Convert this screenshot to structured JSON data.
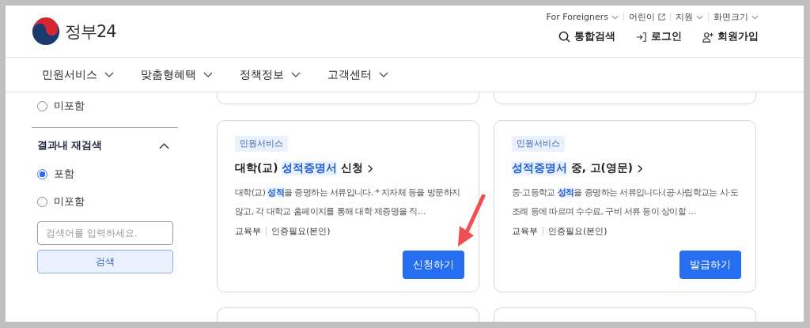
{
  "header": {
    "logo": {
      "text": "정부24"
    },
    "utility_links": [
      {
        "label": "For Foreigners",
        "kind": "dropdown"
      },
      {
        "label": "어린이",
        "kind": "external"
      },
      {
        "label": "지원",
        "kind": "dropdown"
      },
      {
        "label": "화면크기",
        "kind": "dropdown"
      }
    ],
    "actions": [
      {
        "label": "통합검색",
        "kind": "search"
      },
      {
        "label": "로그인",
        "kind": "login"
      },
      {
        "label": "회원가입",
        "kind": "signup"
      }
    ]
  },
  "nav": [
    {
      "label": "민원서비스"
    },
    {
      "label": "맞춤형혜택"
    },
    {
      "label": "정책정보"
    },
    {
      "label": "고객센터"
    }
  ],
  "sidebar": {
    "prev_options": [
      {
        "label": "미포함",
        "selected": false
      }
    ],
    "section": {
      "title": "결과내 재검색",
      "expanded": true,
      "options": [
        {
          "label": "포함",
          "selected": true
        },
        {
          "label": "미포함",
          "selected": false
        }
      ],
      "search": {
        "placeholder": "검색어를 입력하세요.",
        "button": "검색"
      }
    }
  },
  "results": [
    {
      "tag": "민원서비스",
      "title": [
        {
          "text": "대학(교) ",
          "highlight": false
        },
        {
          "text": "성적증명서",
          "highlight": true
        },
        {
          "text": " 신청",
          "highlight": false
        }
      ],
      "description": [
        {
          "text": "대학(교) ",
          "highlight": false
        },
        {
          "text": "성적",
          "highlight": true
        },
        {
          "text": "을 증명하는 서류입니다. * 지자체 등을 방문하지 않고, 각 대학교 홈페이지를 통해 대학 제증명을 직…",
          "highlight": false
        }
      ],
      "meta": [
        "교육부",
        "인증필요(본인)"
      ],
      "button": "신청하기"
    },
    {
      "tag": "민원서비스",
      "title": [
        {
          "text": "성적증명서",
          "highlight": true
        },
        {
          "text": " 중, 고(영문)",
          "highlight": false
        }
      ],
      "description": [
        {
          "text": "중·고등학교 ",
          "highlight": false
        },
        {
          "text": "성적",
          "highlight": true
        },
        {
          "text": "을 증명하는 서류입니다.(공·사립학교는 시·도 조례 등에 따르며 수수료, 구비 서류 등이 상이할 …",
          "highlight": false
        }
      ],
      "meta": [
        "교육부",
        "인증필요(본인)"
      ],
      "button": "발급하기"
    }
  ]
}
